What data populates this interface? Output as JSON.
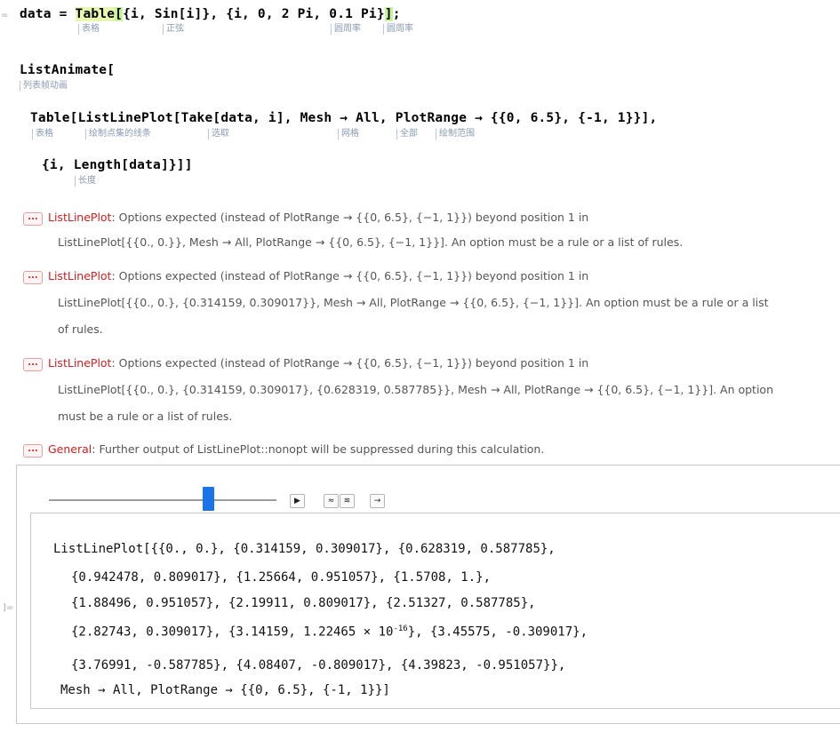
{
  "cell_labels": {
    "input_marker": "=",
    "output_marker": "]="
  },
  "code": {
    "line1": {
      "p1": "data = ",
      "table": "Table",
      "open": "[",
      "p2": "{i, Sin[i]}, {i, 0, 2 Pi, 0.1 Pi}",
      "close": "]",
      "end": ";"
    },
    "line2": "ListAnimate[",
    "line3": "Table[ListLinePlot[Take[data, i], Mesh → All, PlotRange → {{0, 6.5}, {-1, 1}}],",
    "line4": "{i, Length[data]}]]"
  },
  "glosses": {
    "table1": "表格",
    "sin": "正弦",
    "pi1": "圆周率",
    "pi2": "圆周率",
    "listanimate": "列表帧动画",
    "table2": "表格",
    "listlineplot": "绘制点集的线条",
    "take": "选取",
    "mesh": "网格",
    "all": "全部",
    "plotrange": "绘制范围",
    "length": "长度"
  },
  "messages": [
    {
      "function": "ListLinePlot",
      "lines": [
        ": Options expected (instead of PlotRange → {{0, 6.5}, {−1, 1}}) beyond position 1 in",
        "ListLinePlot[{{0., 0.}}, Mesh → All, PlotRange → {{0, 6.5}, {−1, 1}}]. An option must be a rule or a list of rules."
      ]
    },
    {
      "function": "ListLinePlot",
      "lines": [
        ": Options expected (instead of PlotRange → {{0, 6.5}, {−1, 1}}) beyond position 1 in",
        "ListLinePlot[{{0., 0.}, {0.314159, 0.309017}}, Mesh → All, PlotRange → {{0, 6.5}, {−1, 1}}]. An option must be a rule or a list",
        "of rules."
      ]
    },
    {
      "function": "ListLinePlot",
      "lines": [
        ": Options expected (instead of PlotRange → {{0, 6.5}, {−1, 1}}) beyond position 1 in",
        "ListLinePlot[{{0., 0.}, {0.314159, 0.309017}, {0.628319, 0.587785}}, Mesh → All, PlotRange → {{0, 6.5}, {−1, 1}}]. An option",
        "must be a rule or a list of rules."
      ]
    },
    {
      "function": "General",
      "lines": [
        ": Further output of ListLinePlot::nonopt will be suppressed during this calculation."
      ]
    }
  ],
  "message_icon": "...",
  "animation": {
    "slider_position": 0.7,
    "buttons": [
      {
        "name": "play-icon",
        "glyph": "▶"
      },
      {
        "name": "faster-icon",
        "glyph": "≈"
      },
      {
        "name": "slower-icon",
        "glyph": "≋"
      },
      {
        "name": "direction-icon",
        "glyph": "→"
      }
    ]
  },
  "output": {
    "line1": "ListLinePlot[{{0., 0.}, {0.314159, 0.309017}, {0.628319, 0.587785},",
    "line2": "{0.942478, 0.809017}, {1.25664, 0.951057}, {1.5708, 1.},",
    "line3": "{1.88496, 0.951057}, {2.19911, 0.809017}, {2.51327, 0.587785},",
    "line4a": "{2.82743, 0.309017}, {3.14159, 1.22465 × 10",
    "line4_exp": "-16",
    "line4b": "}, {3.45575, -0.309017},",
    "line5": "{3.76991, -0.587785}, {4.08407, -0.809017}, {4.39823, -0.951057}},",
    "line6": "Mesh → All, PlotRange → {{0, 6.5}, {-1, 1}}]"
  }
}
